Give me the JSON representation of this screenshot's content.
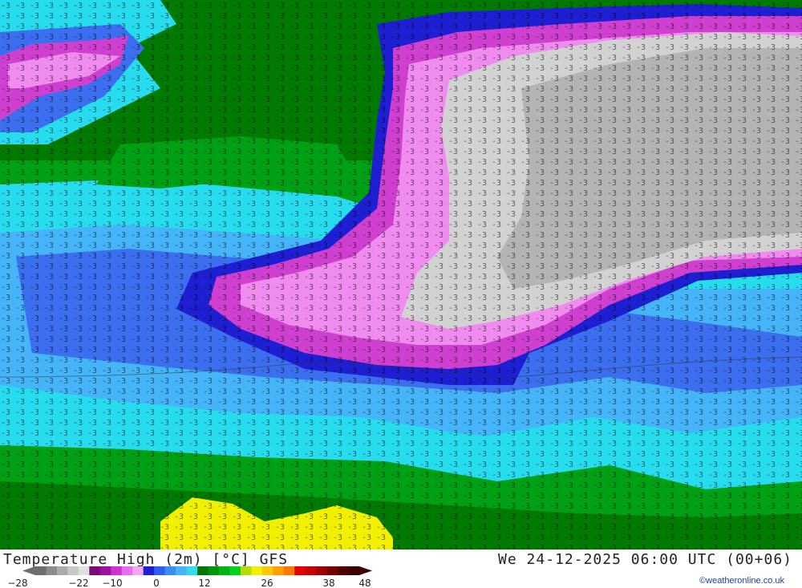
{
  "footer": {
    "title": "Temperature High (2m) [°C] GFS",
    "datetime": "We 24-12-2025 06:00 UTC (00+06)",
    "credit": "©weatheronline.co.uk"
  },
  "legend": {
    "tick_labels": [
      "-28",
      "-22",
      "-10",
      "0",
      "12",
      "26",
      "38",
      "48"
    ],
    "colors": [
      "#6e6e6e",
      "#8c8c8c",
      "#aaaaaa",
      "#c8c8c8",
      "#e0e0e0",
      "#7a0a7a",
      "#a010a0",
      "#d030d0",
      "#ea6cea",
      "#f4a6f4",
      "#1e1ed2",
      "#2e5ef0",
      "#3c8cf5",
      "#46b4f8",
      "#32dcf0",
      "#007800",
      "#00960a",
      "#00b414",
      "#00d21e",
      "#b4dc00",
      "#f0f000",
      "#ffc800",
      "#ffa000",
      "#ff7800",
      "#e60000",
      "#c80000",
      "#a00000",
      "#780000",
      "#500000",
      "#3c0000"
    ]
  },
  "map": {
    "region_colors": {
      "cold_gray": "#b4b4b4",
      "light_gray": "#d2d2d2",
      "magenta": "#d040d0",
      "pink": "#f08cf0",
      "deep_blue": "#1e1ed2",
      "blue": "#3c6ef0",
      "sky": "#46b4f8",
      "cyan": "#28dcf0",
      "green": "#00a014",
      "dark_green": "#007a00",
      "yellow": "#f0f000"
    }
  }
}
